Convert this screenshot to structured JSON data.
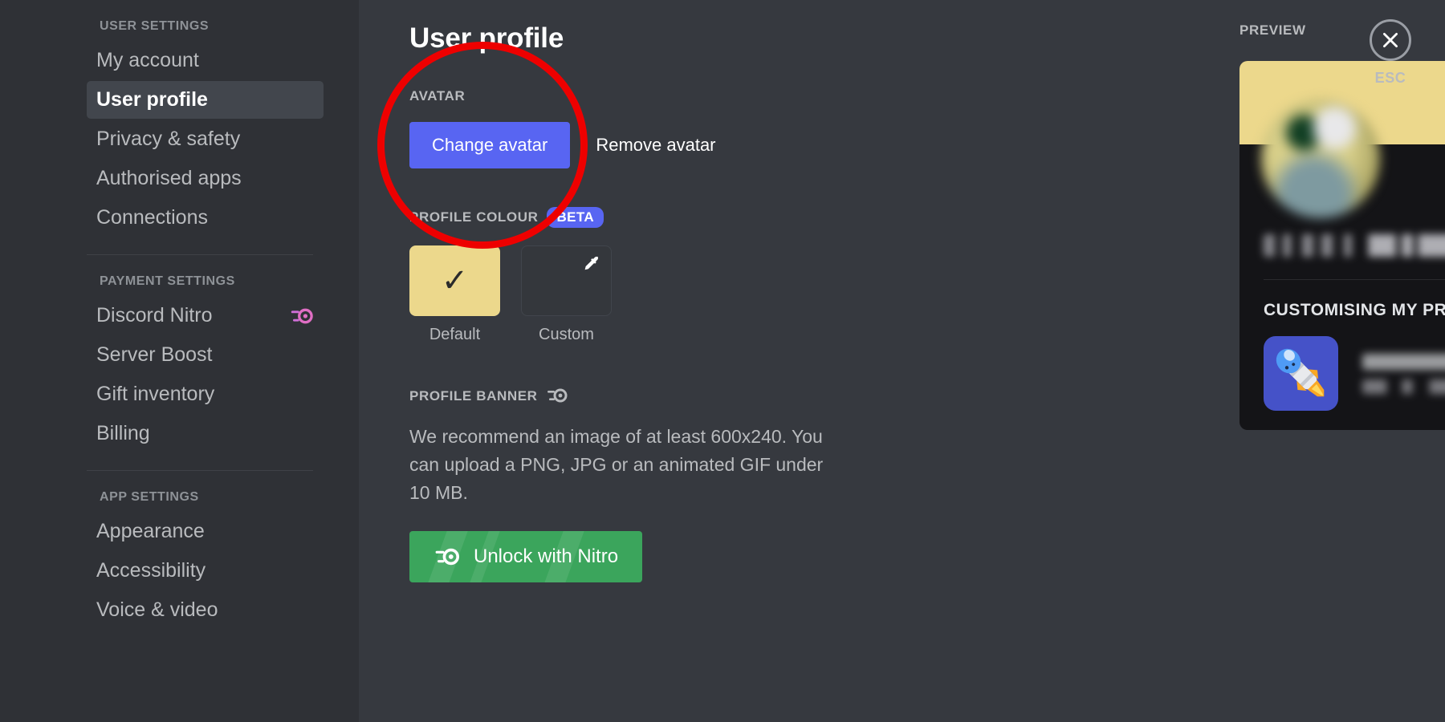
{
  "sidebar": {
    "groups": [
      {
        "header": "USER SETTINGS",
        "items": [
          {
            "label": "My account",
            "active": false,
            "badge_icon": ""
          },
          {
            "label": "User profile",
            "active": true,
            "badge_icon": ""
          },
          {
            "label": "Privacy & safety",
            "active": false,
            "badge_icon": ""
          },
          {
            "label": "Authorised apps",
            "active": false,
            "badge_icon": ""
          },
          {
            "label": "Connections",
            "active": false,
            "badge_icon": ""
          }
        ]
      },
      {
        "header": "PAYMENT SETTINGS",
        "items": [
          {
            "label": "Discord Nitro",
            "active": false,
            "badge_icon": "nitro-wheel-icon"
          },
          {
            "label": "Server Boost",
            "active": false,
            "badge_icon": ""
          },
          {
            "label": "Gift inventory",
            "active": false,
            "badge_icon": ""
          },
          {
            "label": "Billing",
            "active": false,
            "badge_icon": ""
          }
        ]
      },
      {
        "header": "APP SETTINGS",
        "items": [
          {
            "label": "Appearance",
            "active": false,
            "badge_icon": ""
          },
          {
            "label": "Accessibility",
            "active": false,
            "badge_icon": ""
          },
          {
            "label": "Voice & video",
            "active": false,
            "badge_icon": ""
          }
        ]
      }
    ]
  },
  "main": {
    "title": "User profile",
    "avatar": {
      "label": "AVATAR",
      "change_button": "Change avatar",
      "remove_button": "Remove avatar"
    },
    "profile_colour": {
      "label": "PROFILE COLOUR",
      "badge": "BETA",
      "swatches": [
        {
          "caption": "Default",
          "colour": "#ecd88c",
          "selected": true,
          "icon": "check-icon"
        },
        {
          "caption": "Custom",
          "colour": "#34373c",
          "selected": false,
          "icon": "eyedropper-icon"
        }
      ]
    },
    "profile_banner": {
      "label": "PROFILE BANNER",
      "label_icon": "nitro-wheel-icon",
      "description": "We recommend an image of at least 600x240. You can upload a PNG, JPG or an animated GIF under 10 MB.",
      "unlock_button": "Unlock with Nitro",
      "unlock_button_icon": "nitro-wheel-icon"
    }
  },
  "preview": {
    "label": "PREVIEW",
    "banner_colour": "#ecd88c",
    "username_redacted": true,
    "activity_header": "CUSTOMISING MY PROFILE",
    "activity_icon": "rocket-pencil-icon",
    "activity_lines_redacted": true
  },
  "close": {
    "icon": "close-icon",
    "label": "ESC"
  },
  "annotation": {
    "shape": "circle",
    "colour": "#ee0000",
    "targets": "change-avatar-button"
  },
  "colors": {
    "sidebar_bg": "#2f3136",
    "main_bg": "#36393f",
    "accent_blurple": "#5865f2",
    "nitro_green": "#3ba55c",
    "profile_yellow": "#ecd88c",
    "card_bg": "#141417",
    "annotation_red": "#ee0000"
  }
}
